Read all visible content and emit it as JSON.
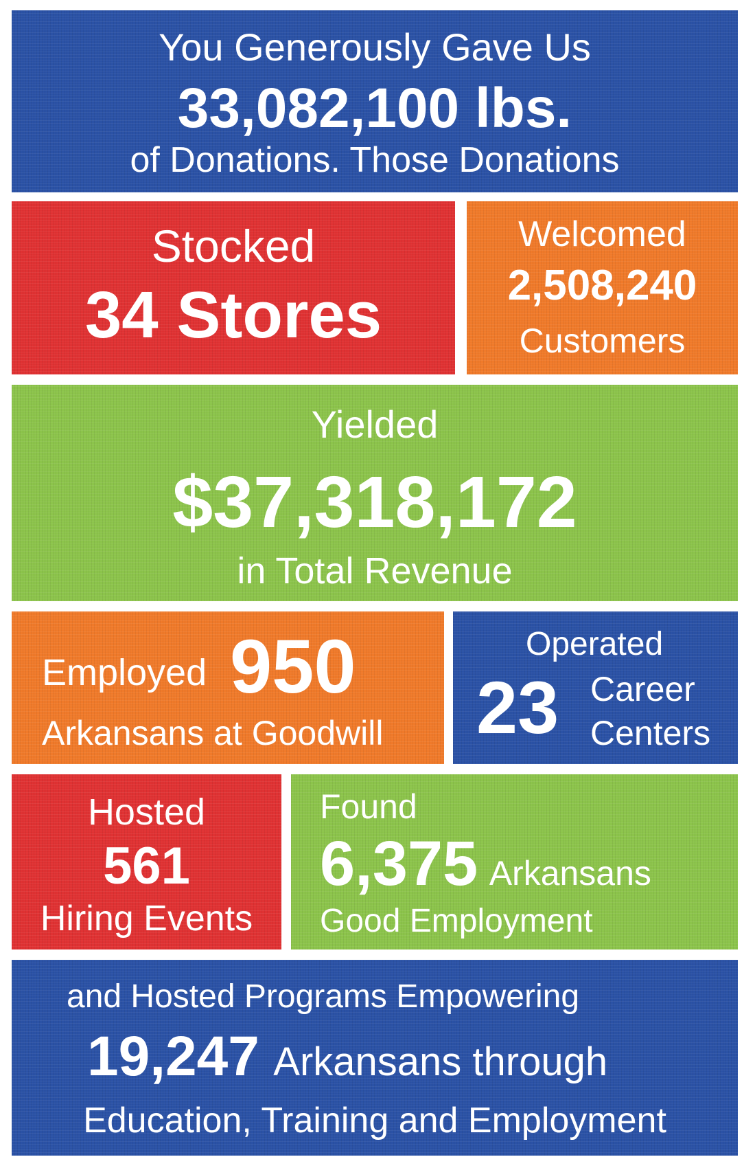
{
  "colors": {
    "blue": "#2b52a6",
    "red": "#e03233",
    "orange": "#f07a2a",
    "green": "#8cc44b",
    "text": "#ffffff"
  },
  "donations": {
    "intro": "You Generously Gave Us",
    "amount": "33,082,100 lbs.",
    "outro": "of Donations. Those Donations"
  },
  "stores": {
    "label": "Stocked",
    "value": "34 Stores"
  },
  "customers": {
    "label": "Welcomed",
    "value": "2,508,240",
    "unit": "Customers"
  },
  "revenue": {
    "label": "Yielded",
    "value": "$37,318,172",
    "unit": "in Total Revenue"
  },
  "employed": {
    "label": "Employed",
    "value": "950",
    "unit": "Arkansans at Goodwill"
  },
  "career_centers": {
    "label": "Operated",
    "value": "23",
    "line1": "Career",
    "line2": "Centers"
  },
  "hiring": {
    "label": "Hosted",
    "value": "561",
    "unit": "Hiring Events"
  },
  "employment": {
    "label": "Found",
    "value": "6,375",
    "unit": "Arkansans",
    "line2": "Good Employment"
  },
  "programs": {
    "intro": "and Hosted Programs Empowering",
    "value": "19,247",
    "unit": "Arkansans through",
    "line3": "Education, Training and Employment"
  }
}
